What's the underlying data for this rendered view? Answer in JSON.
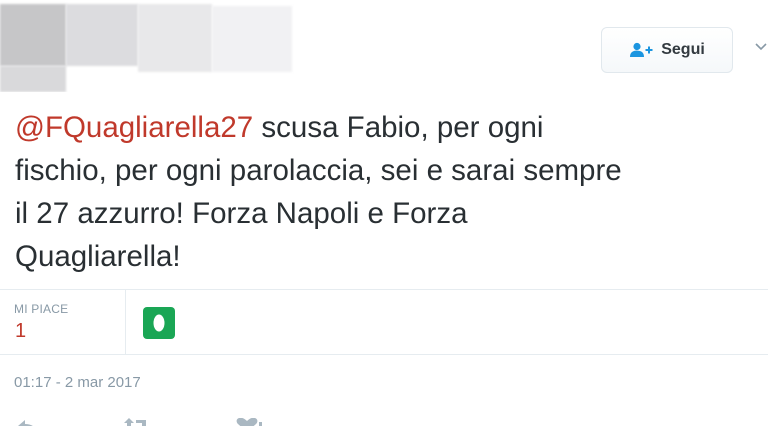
{
  "header": {
    "follow_button_label": "Segui"
  },
  "tweet": {
    "mention": "@FQuagliarella27",
    "lines": [
      " scusa Fabio, per ogni",
      "fischio, per ogni parolaccia, sei e sarai sempre",
      "il 27 azzurro! Forza Napoli e Forza",
      "Quagliarella!"
    ]
  },
  "stats": {
    "likes_label": "MI PIACE",
    "likes_count": "1"
  },
  "meta": {
    "timestamp": "01:17 - 2 mar 2017"
  },
  "colors": {
    "mention": "#c0392b",
    "likes_count": "#c0392b",
    "liker_avatar": "#1aa655",
    "secondary_text": "#8899a6",
    "follow_icon": "#1b95e0"
  },
  "icons": {
    "follow": "add-user-icon",
    "dropdown": "chevron-down-icon",
    "reply": "reply-icon",
    "retweet": "retweet-icon",
    "like": "heart-icon"
  }
}
